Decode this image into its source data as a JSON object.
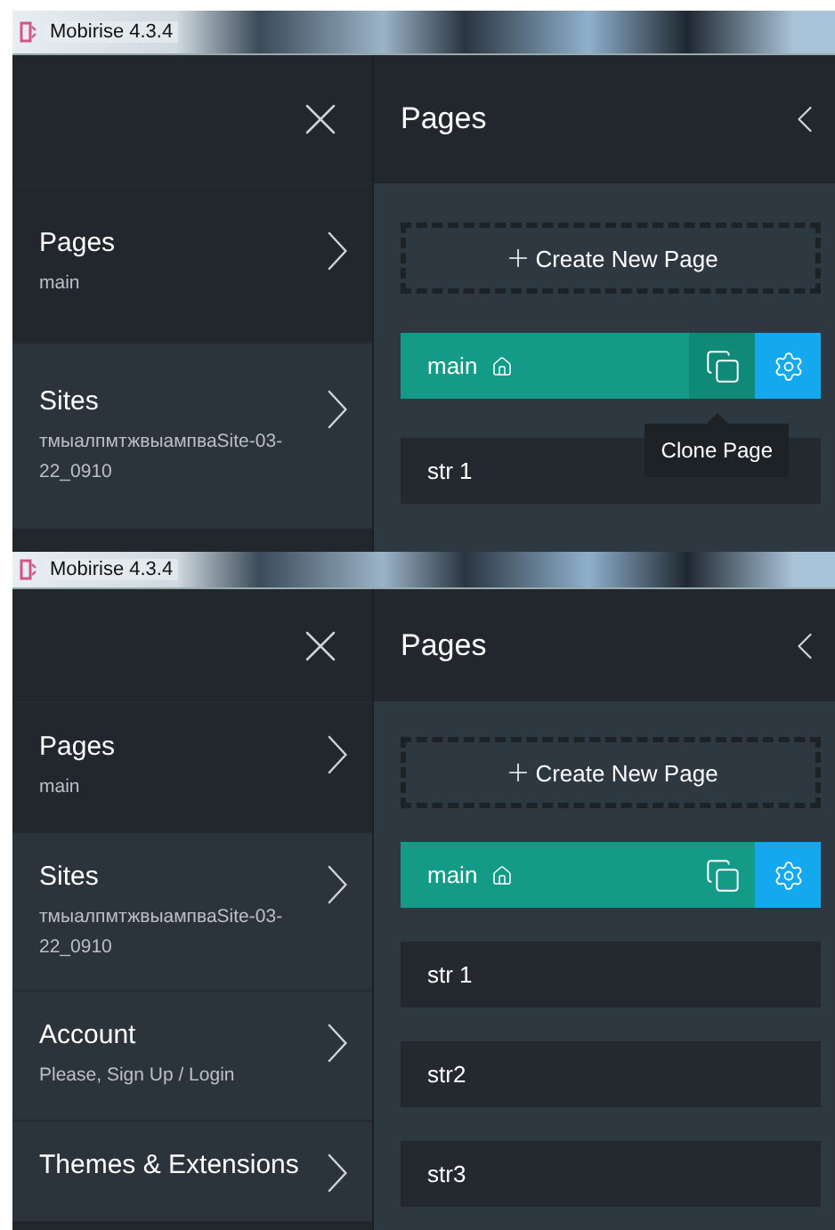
{
  "panels": [
    {
      "title": "Mobirise 4.3.4",
      "menu_items": [
        {
          "label": "Pages",
          "sub": "main",
          "selected": true
        },
        {
          "label": "Sites",
          "sub": "тмыалпмтжвыампваSite-03-22_0910",
          "selected": false
        }
      ],
      "pages_panel": {
        "title": "Pages",
        "create_label": "Create New Page",
        "tooltip": "Clone Page",
        "pages": [
          {
            "name": "main",
            "selected": true,
            "home": true,
            "clone_hovered": true
          },
          {
            "name": "str 1",
            "selected": false,
            "home": false,
            "clone_hovered": false
          }
        ]
      }
    },
    {
      "title": "Mobirise 4.3.4",
      "menu_items": [
        {
          "label": "Pages",
          "sub": "main",
          "selected": true
        },
        {
          "label": "Sites",
          "sub": "тмыалпмтжвыампваSite-03-22_0910",
          "selected": false
        },
        {
          "label": "Account",
          "sub": "Please, Sign Up / Login",
          "selected": false
        },
        {
          "label": "Themes & Extensions",
          "selected": false
        }
      ],
      "pages_panel": {
        "title": "Pages",
        "create_label": "Create New Page",
        "pages": [
          {
            "name": "main",
            "selected": true,
            "home": true,
            "clone_hovered": false
          },
          {
            "name": "str 1",
            "selected": false,
            "home": false,
            "clone_hovered": false
          },
          {
            "name": "str2",
            "selected": false,
            "home": false,
            "clone_hovered": false
          },
          {
            "name": "str3",
            "selected": false,
            "home": false,
            "clone_hovered": false
          }
        ]
      }
    }
  ]
}
